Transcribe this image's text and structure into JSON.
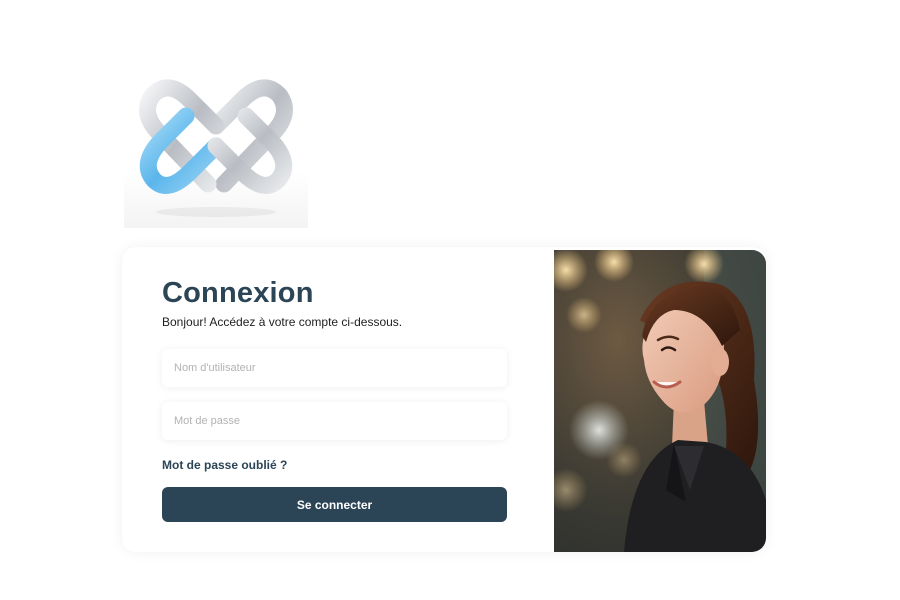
{
  "logo": {
    "icon": "interlocking-loops-logo"
  },
  "login": {
    "title": "Connexion",
    "subtitle": "Bonjour! Accédez à votre compte ci-dessous.",
    "username_placeholder": "Nom d'utilisateur",
    "password_placeholder": "Mot de passe",
    "forgot_label": "Mot de passe oublié ?",
    "submit_label": "Se connecter"
  },
  "photo": {
    "subject": "smiling-woman-portrait"
  },
  "colors": {
    "primary": "#2b4557",
    "placeholder": "#b2b2b2",
    "logo_blue": "#6cc2f2",
    "logo_silver": "#c9ccd1"
  }
}
